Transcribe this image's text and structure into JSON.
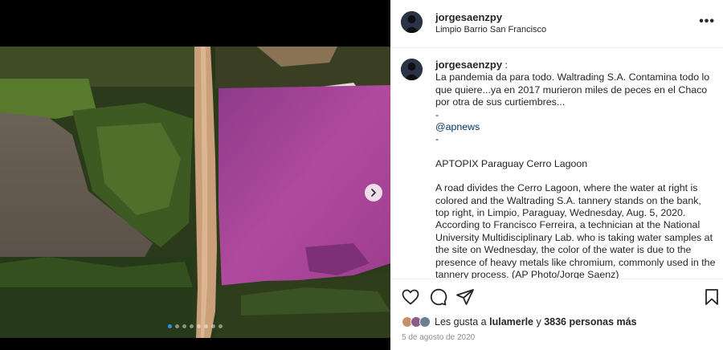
{
  "post": {
    "username": "jorgesaenzpy",
    "location": "Limpio Barrio San Francisco",
    "more_icon": "more-horizontal-icon",
    "caption": {
      "username": "jorgesaenzpy",
      "separator": " :",
      "line1": "La pandemia da para todo. Waltrading S.A. Contamina todo lo que quiere...ya en 2017 murieron miles de peces en el Chaco por otra de sus curtiembres...",
      "dash1": "-",
      "mention": "@apnews",
      "dash2": "-",
      "headline": "APTOPIX Paraguay Cerro Lagoon",
      "body": "A road divides the Cerro Lagoon, where the water at right is colored and the Waltrading S.A. tannery stands on the bank, top right, in Limpio, Paraguay, Wednesday, Aug. 5, 2020. According to Francisco Ferreira, a technician at the National University Multidisciplinary Lab. who is taking water samples at the site on Wednesday, the color of the water is due to the presence of heavy metals like chromium, commonly used in the tannery process. (AP Photo/Jorge Saenz)"
    },
    "likes": {
      "prefix": "Les gusta a ",
      "user": "lulamerle",
      "middle": " y ",
      "count": "3836 personas más"
    },
    "date": "5 de agosto de 2020",
    "carousel": {
      "count": 8,
      "active": 0
    },
    "icons": [
      "heart-icon",
      "comment-icon",
      "share-icon",
      "bookmark-icon",
      "chevron-right-icon"
    ],
    "colors": {
      "accent": "#2f8df5",
      "link": "#00376b",
      "lagoon": "#a33e96"
    }
  }
}
